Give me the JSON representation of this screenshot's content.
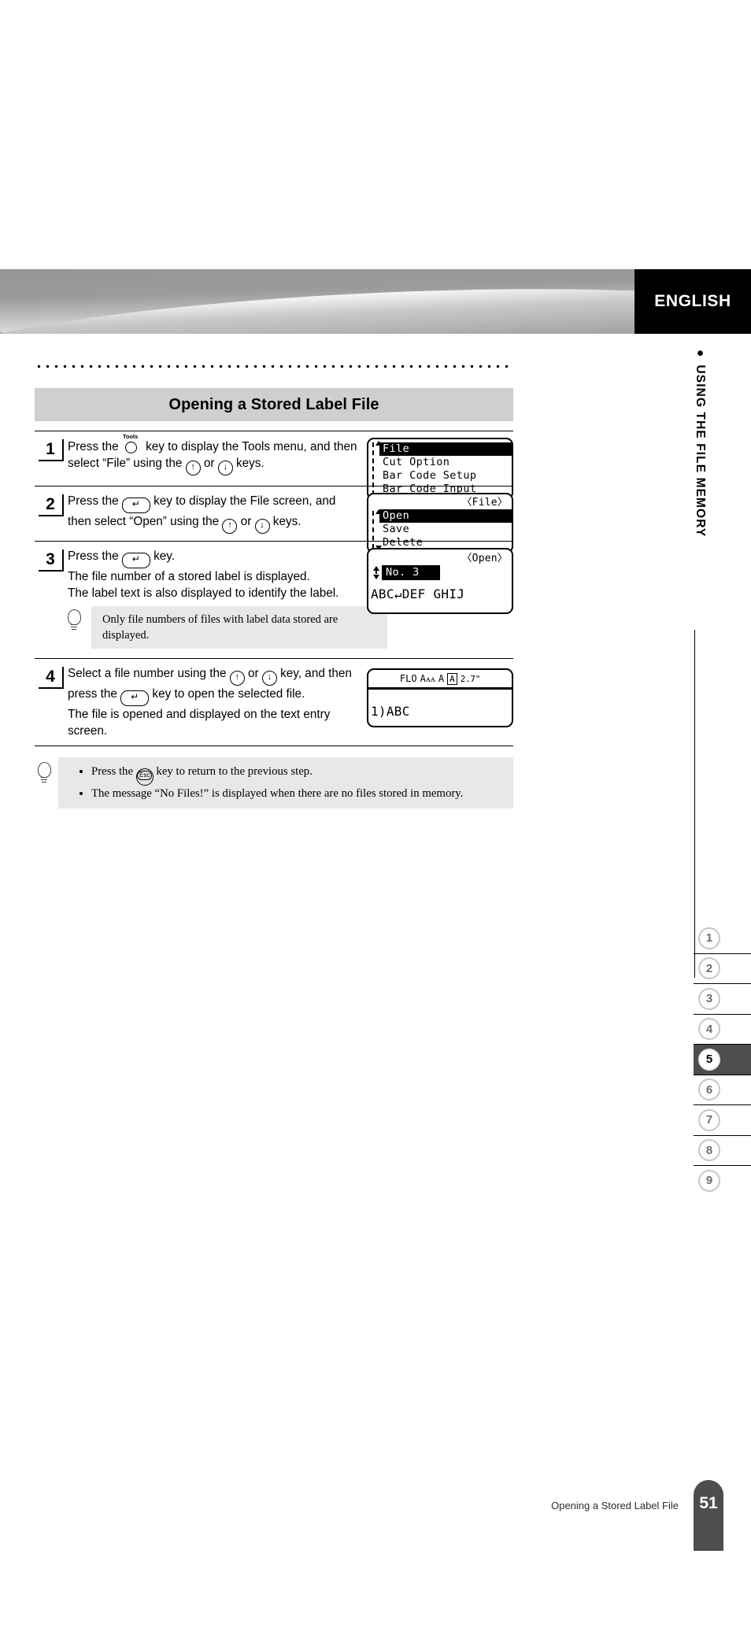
{
  "banner": {
    "language_label": "ENGLISH"
  },
  "sidebar": {
    "chapter_label": "● USING THE FILE MEMORY",
    "page_tabs": [
      {
        "label": "1",
        "active": false
      },
      {
        "label": "2",
        "active": false
      },
      {
        "label": "3",
        "active": false
      },
      {
        "label": "4",
        "active": false
      },
      {
        "label": "5",
        "active": true
      },
      {
        "label": "6",
        "active": false
      },
      {
        "label": "7",
        "active": false
      },
      {
        "label": "8",
        "active": false
      },
      {
        "label": "9",
        "active": false
      }
    ]
  },
  "page": {
    "title": "Opening a Stored Label File",
    "footer_caption": "Opening a Stored Label File",
    "footer_page_number": "51"
  },
  "steps": [
    {
      "number": "1",
      "lines": [
        "Press the [tools] key to display the Tools menu, and then",
        "select “File” using the [up] or [down] keys."
      ],
      "text_part_1": "Press the ",
      "text_part_2": " key to display the Tools menu, and then select “File” using the ",
      "text_part_3": " or ",
      "text_part_4": " keys.",
      "lcd": {
        "type": "menu",
        "scroll_up": true,
        "scroll_down": false,
        "rows": [
          {
            "text": "File",
            "selected": true
          },
          {
            "text": "Cut Option",
            "selected": false
          },
          {
            "text": "Bar Code Setup",
            "selected": false
          },
          {
            "text": "Bar Code Input",
            "selected": false
          }
        ]
      }
    },
    {
      "number": "2",
      "text_part_1": "Press the ",
      "text_part_2": " key to display the File screen, and then select “Open” using the ",
      "text_part_3": " or ",
      "text_part_4": " keys.",
      "lcd": {
        "type": "menu",
        "title": "〈File〉",
        "scroll_up": true,
        "scroll_down": true,
        "rows": [
          {
            "text": "Open",
            "selected": true
          },
          {
            "text": "Save",
            "selected": false
          },
          {
            "text": "Delete",
            "selected": false
          }
        ]
      }
    },
    {
      "number": "3",
      "text_part_1": "Press the ",
      "text_part_2": " key.",
      "line2": "The file number of a stored label is displayed.",
      "line3": "The label text is also displayed to identify the label.",
      "tip": "Only file numbers of files with label data stored are displayed.",
      "lcd": {
        "type": "open",
        "title": "〈Open〉",
        "selected_row": "No. 3",
        "label_text": "ABC↵DEF GHIJ"
      }
    },
    {
      "number": "4",
      "text_part_1": "Select a file number using the ",
      "text_part_2": " or ",
      "text_part_3": " key, and then press the ",
      "text_part_4": " key to open the selected file.",
      "line3": "The file is opened and displayed on the text entry",
      "line4": "screen.",
      "lcd": {
        "type": "entry",
        "status_font": "FLO",
        "status_size_icon": "Aᴀᴀ",
        "status_style_icon": "A",
        "status_frame_icon": "A",
        "status_length": "2.7\"",
        "entry_text": "1)ABC"
      }
    }
  ],
  "footer_tip": {
    "bullets": [
      "Press the [esc] key to return to the previous step.",
      "The message “No Files!” is displayed when there are no files stored in memory."
    ],
    "bullet1_part1": "Press the ",
    "bullet1_part2": " key to return to the previous step.",
    "bullet2": "The message “No Files!” is displayed when there are no files stored in memory."
  },
  "keys": {
    "tools_label": "Tools",
    "enter_glyph": "↵",
    "up_glyph": "↑",
    "down_glyph": "↓",
    "esc_label": "Esc"
  }
}
